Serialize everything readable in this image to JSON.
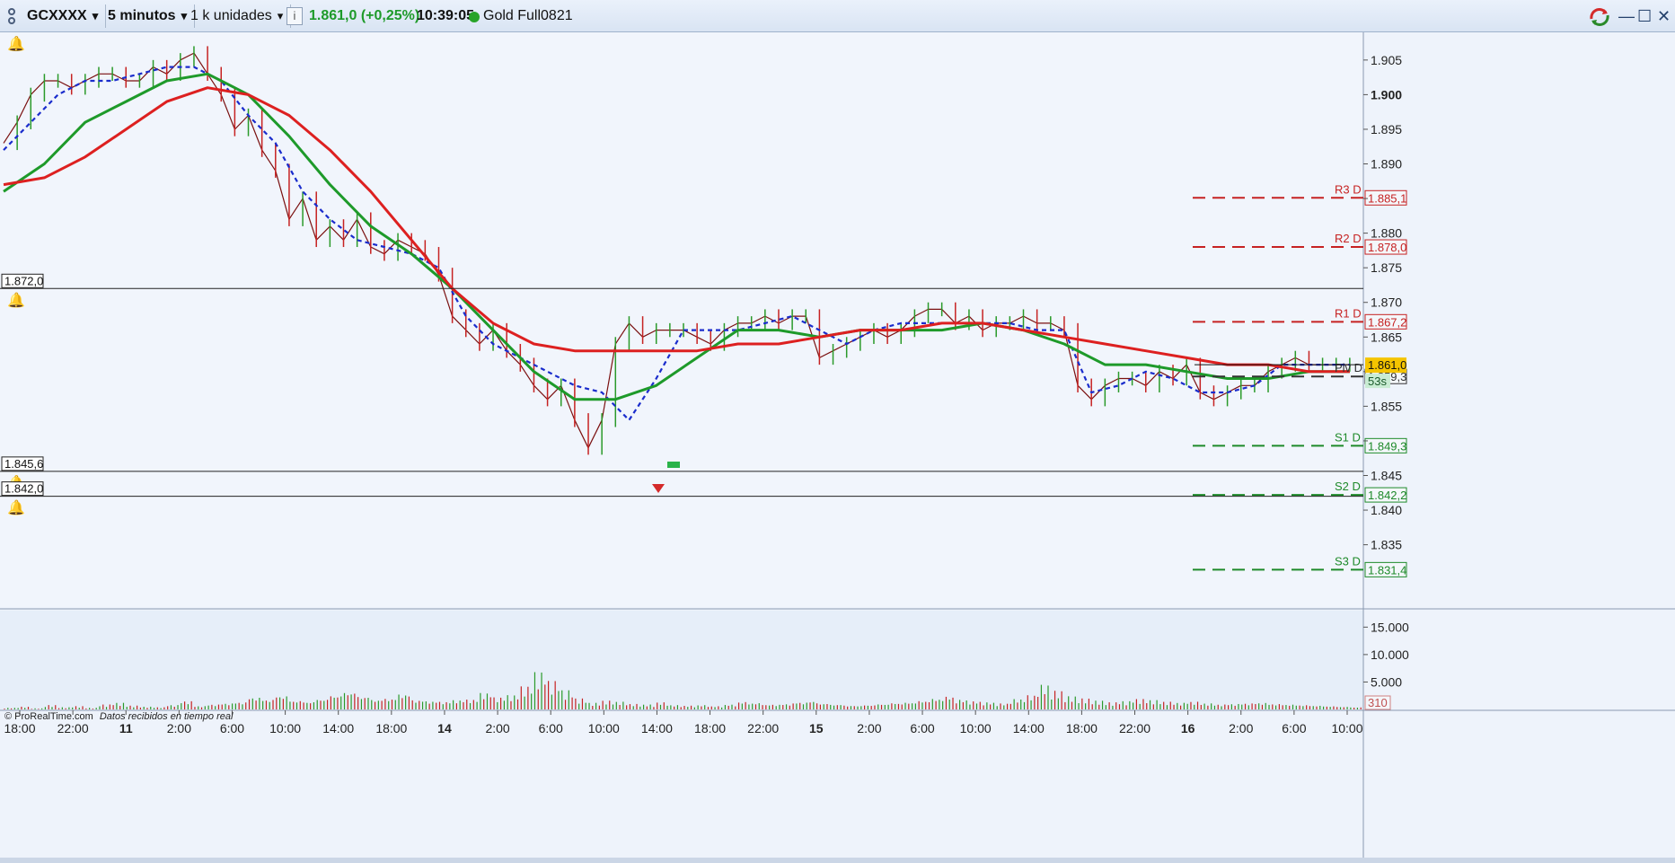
{
  "toolbar": {
    "symbol": "GCXXXX",
    "timeframe": "5 minutos",
    "units": "1 k unidades",
    "info_icon": "info-icon",
    "price_change": "1.861,0 (+0,25%)",
    "time": "10:39:05",
    "status_color": "#28a428",
    "instrument": "Gold Full0821",
    "controls": {
      "refresh_icon": "sync-icon",
      "minimize": "—",
      "maximize": "☐",
      "close": "✕"
    }
  },
  "copyright": {
    "brand": "© ProRealTime.com",
    "status": "Datos recibidos en tiempo real"
  },
  "colors": {
    "up": "#2a9a2a",
    "down": "#c62222",
    "price_line": "#7a1010",
    "ma_green": "#1e9a2a",
    "ma_red": "#dd2020",
    "ma_blue": "#1a2ccc",
    "price_badge": "#f5c400"
  },
  "chart_data": {
    "type": "line",
    "x_ticks": [
      "18:00",
      "22:00",
      "11",
      "2:00",
      "6:00",
      "10:00",
      "14:00",
      "18:00",
      "14",
      "2:00",
      "6:00",
      "10:00",
      "14:00",
      "18:00",
      "22:00",
      "15",
      "2:00",
      "6:00",
      "10:00",
      "14:00",
      "18:00",
      "22:00",
      "16",
      "2:00",
      "6:00",
      "10:00"
    ],
    "y_ticks": [
      "1.905",
      "1.900",
      "1.895",
      "1.890",
      "1.885",
      "1.880",
      "1.875",
      "1.870",
      "1.865",
      "1.860",
      "1.855",
      "1.850",
      "1.845",
      "1.840",
      "1.835"
    ],
    "y_ticks_shown": [
      "1.905",
      "1.900",
      "1.895",
      "1.890",
      "1.880",
      "1.875",
      "1.870",
      "1.865",
      "1.855",
      "1.845",
      "1.840",
      "1.835"
    ],
    "ylim": [
      1.826,
      1.909
    ],
    "x_range": [
      0,
      100
    ],
    "series": [
      {
        "name": "",
        "style": "price",
        "x": [
          0,
          1,
          2,
          3,
          4,
          5,
          6,
          7,
          8,
          9,
          10,
          11,
          12,
          13,
          14,
          15,
          16,
          17,
          18,
          19,
          20,
          21,
          22,
          23,
          24,
          25,
          26,
          27,
          28,
          29,
          30,
          31,
          32,
          33,
          34,
          35,
          36,
          37,
          38,
          39,
          40,
          41,
          42,
          43,
          44,
          45,
          46,
          47,
          48,
          49,
          50,
          51,
          52,
          53,
          54,
          55,
          56,
          57,
          58,
          59,
          60,
          61,
          62,
          63,
          64,
          65,
          66,
          67,
          68,
          69,
          70,
          71,
          72,
          73,
          74,
          75,
          76,
          77,
          78,
          79,
          80,
          81,
          82,
          83,
          84,
          85,
          86,
          87,
          88,
          89,
          90,
          91,
          92,
          93,
          94,
          95,
          96,
          97,
          98,
          99
        ],
        "y": [
          1.893,
          1.896,
          1.9,
          1.902,
          1.902,
          1.901,
          1.902,
          1.903,
          1.903,
          1.902,
          1.902,
          1.904,
          1.903,
          1.905,
          1.906,
          1.903,
          1.9,
          1.895,
          1.897,
          1.892,
          1.889,
          1.882,
          1.885,
          1.879,
          1.881,
          1.879,
          1.882,
          1.878,
          1.877,
          1.879,
          1.878,
          1.877,
          1.874,
          1.868,
          1.866,
          1.864,
          1.866,
          1.863,
          1.861,
          1.858,
          1.856,
          1.858,
          1.853,
          1.849,
          1.853,
          1.864,
          1.867,
          1.865,
          1.866,
          1.866,
          1.866,
          1.865,
          1.864,
          1.866,
          1.867,
          1.867,
          1.868,
          1.867,
          1.868,
          1.868,
          1.862,
          1.863,
          1.864,
          1.865,
          1.866,
          1.865,
          1.866,
          1.868,
          1.869,
          1.869,
          1.867,
          1.868,
          1.866,
          1.867,
          1.867,
          1.868,
          1.867,
          1.867,
          1.866,
          1.858,
          1.856,
          1.858,
          1.859,
          1.859,
          1.858,
          1.86,
          1.859,
          1.861,
          1.857,
          1.856,
          1.857,
          1.858,
          1.858,
          1.86,
          1.861,
          1.862,
          1.861,
          1.861,
          1.861,
          1.861
        ]
      },
      {
        "name": "",
        "style": "blue-dashed",
        "x": [
          0,
          2,
          4,
          6,
          8,
          10,
          12,
          14,
          16,
          18,
          20,
          22,
          24,
          26,
          28,
          30,
          32,
          34,
          36,
          38,
          40,
          42,
          44,
          46,
          48,
          50,
          52,
          54,
          56,
          58,
          60,
          62,
          64,
          66,
          68,
          70,
          72,
          74,
          76,
          78,
          80,
          82,
          84,
          86,
          88,
          90,
          92,
          94,
          96,
          98,
          99
        ],
        "y": [
          1.892,
          1.896,
          1.9,
          1.902,
          1.902,
          1.903,
          1.904,
          1.904,
          1.902,
          1.897,
          1.893,
          1.886,
          1.882,
          1.879,
          1.878,
          1.877,
          1.875,
          1.868,
          1.864,
          1.862,
          1.86,
          1.858,
          1.857,
          1.853,
          1.859,
          1.866,
          1.866,
          1.866,
          1.867,
          1.868,
          1.866,
          1.864,
          1.866,
          1.867,
          1.867,
          1.867,
          1.867,
          1.867,
          1.866,
          1.866,
          1.857,
          1.858,
          1.86,
          1.859,
          1.857,
          1.857,
          1.858,
          1.861,
          1.861,
          1.861,
          1.861
        ]
      },
      {
        "name": "",
        "style": "green",
        "x": [
          0,
          3,
          6,
          9,
          12,
          15,
          18,
          21,
          24,
          27,
          30,
          33,
          36,
          39,
          42,
          45,
          48,
          51,
          54,
          57,
          60,
          63,
          66,
          69,
          72,
          75,
          78,
          81,
          84,
          87,
          90,
          93,
          96,
          99
        ],
        "y": [
          1.886,
          1.89,
          1.896,
          1.899,
          1.902,
          1.903,
          1.9,
          1.894,
          1.887,
          1.881,
          1.877,
          1.872,
          1.866,
          1.86,
          1.856,
          1.856,
          1.858,
          1.862,
          1.866,
          1.866,
          1.865,
          1.866,
          1.866,
          1.866,
          1.867,
          1.866,
          1.864,
          1.861,
          1.861,
          1.86,
          1.859,
          1.859,
          1.86,
          1.86
        ]
      },
      {
        "name": "",
        "style": "red",
        "x": [
          0,
          3,
          6,
          9,
          12,
          15,
          18,
          21,
          24,
          27,
          30,
          33,
          36,
          39,
          42,
          45,
          48,
          51,
          54,
          57,
          60,
          63,
          66,
          69,
          72,
          75,
          78,
          81,
          84,
          87,
          90,
          93,
          96,
          99
        ],
        "y": [
          1.887,
          1.888,
          1.891,
          1.895,
          1.899,
          1.901,
          1.9,
          1.897,
          1.892,
          1.886,
          1.879,
          1.872,
          1.867,
          1.864,
          1.863,
          1.863,
          1.863,
          1.863,
          1.864,
          1.864,
          1.865,
          1.866,
          1.866,
          1.867,
          1.867,
          1.866,
          1.865,
          1.864,
          1.863,
          1.862,
          1.861,
          1.861,
          1.86,
          1.86
        ]
      }
    ],
    "pivots": [
      {
        "label": "R3 D",
        "value": "1.885,1",
        "y": 1.8851,
        "color": "#c62222"
      },
      {
        "label": "R2 D",
        "value": "1.878,0",
        "y": 1.878,
        "color": "#c62222"
      },
      {
        "label": "R1 D",
        "value": "1.867,2",
        "y": 1.8672,
        "color": "#c62222"
      },
      {
        "label": "Piv D",
        "value": "1.859,3",
        "y": 1.8593,
        "color": "#333333"
      },
      {
        "label": "S1 D",
        "value": "1.849,3",
        "y": 1.8493,
        "color": "#1e8a2a"
      },
      {
        "label": "S2 D",
        "value": "1.842,2",
        "y": 1.8422,
        "color": "#1e8a2a"
      },
      {
        "label": "S3 D",
        "value": "1.831,4",
        "y": 1.8314,
        "color": "#1e8a2a"
      }
    ],
    "horizontal_lines": [
      {
        "label": "1.872,0",
        "y": 1.872
      },
      {
        "label": "1.845,6",
        "y": 1.8456
      },
      {
        "label": "1.842,0",
        "y": 1.842
      }
    ],
    "current_price": {
      "value": "1.861,0",
      "y": 1.861,
      "countdown": "53s"
    },
    "volume": {
      "y_ticks": [
        "15.000",
        "10.000",
        "5.000"
      ],
      "ylim": [
        0,
        18000
      ],
      "last_value": "310",
      "bars": [
        300,
        500,
        200,
        800,
        400,
        600,
        300,
        900,
        1200,
        700,
        500,
        400,
        800,
        1500,
        600,
        900,
        1100,
        1300,
        2200,
        1800,
        2500,
        1600,
        1400,
        1900,
        2600,
        3200,
        2400,
        1800,
        2000,
        2800,
        1700,
        1500,
        1400,
        1700,
        1800,
        3000,
        2200,
        2600,
        4200,
        6800,
        5200,
        3500,
        2000,
        1200,
        1600,
        1400,
        1000,
        900,
        1300,
        800,
        700,
        800,
        600,
        900,
        1400,
        1200,
        900,
        1000,
        1300,
        1500,
        1100,
        900,
        700,
        800,
        1000,
        1200,
        1300,
        1600,
        2000,
        2400,
        1800,
        1500,
        1300,
        1100,
        1900,
        2600,
        4500,
        3400,
        2400,
        2000,
        1600,
        1300,
        1500,
        1900,
        1700,
        1400,
        1200,
        1400,
        1100,
        900,
        1000,
        1100,
        1200,
        1000,
        900,
        800,
        700,
        600,
        500,
        400
      ]
    }
  }
}
